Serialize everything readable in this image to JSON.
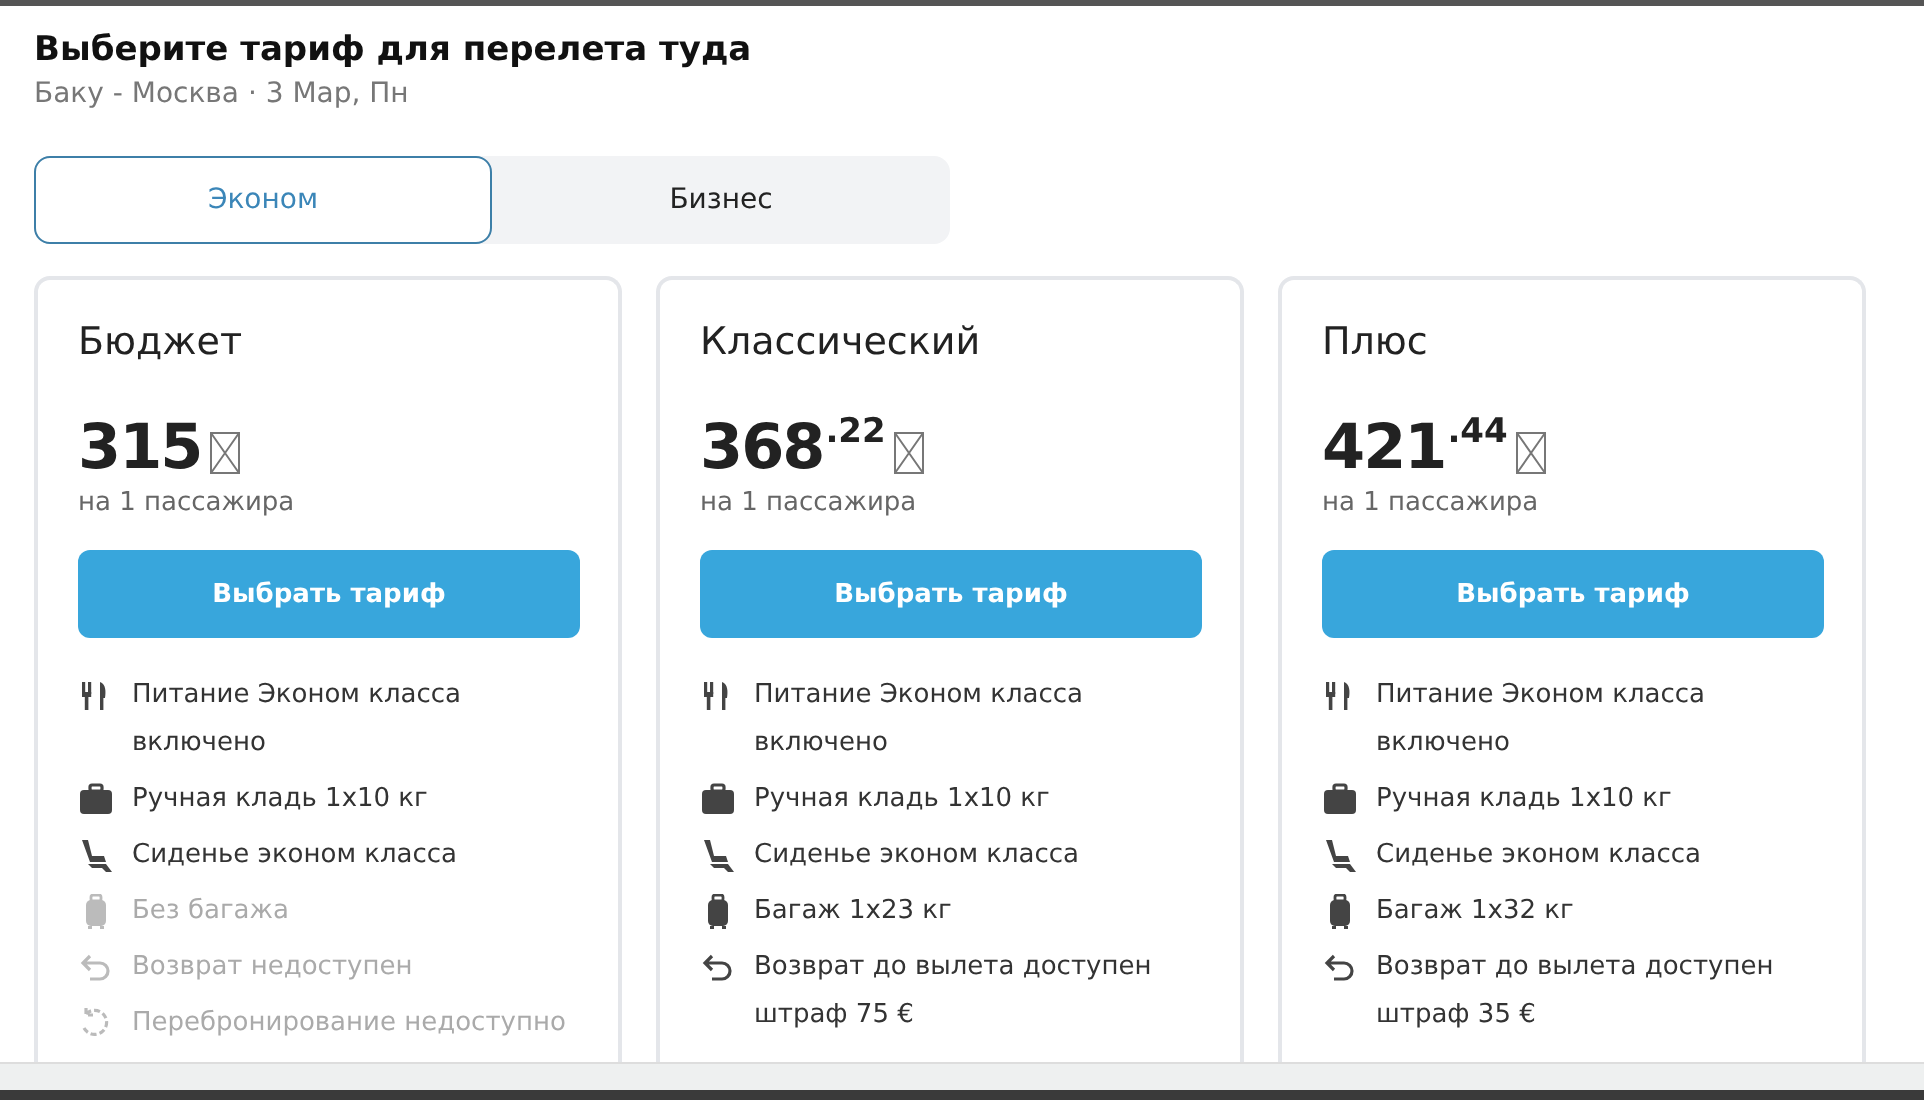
{
  "title": "Выберите тариф для перелета туда",
  "subtitle": "Баку - Москва · 3 Мар, Пн",
  "tabs": [
    {
      "label": "Эконом",
      "selected": true
    },
    {
      "label": "Бизнес",
      "selected": false
    }
  ],
  "fares": [
    {
      "name": "Бюджет",
      "price": "315",
      "per": "на 1 пассажира",
      "button": "Выбрать тариф",
      "features": [
        {
          "kind": "meal",
          "text": "Питание Эконом класса включено",
          "available": true
        },
        {
          "kind": "hand-luggage",
          "text": "Ручная кладь 1x10 кг",
          "available": true
        },
        {
          "kind": "seat",
          "text": "Сиденье эконом класса",
          "available": true
        },
        {
          "kind": "baggage",
          "text": "Без багажа",
          "available": false
        },
        {
          "kind": "refund",
          "text": "Возврат недоступен",
          "available": false
        },
        {
          "kind": "rebooking",
          "text": "Перебронирование недоступно",
          "available": false
        }
      ]
    },
    {
      "name": "Классический",
      "price": "368",
      "cents": ".22",
      "per": "на 1 пассажира",
      "button": "Выбрать тариф",
      "features": [
        {
          "kind": "meal",
          "text": "Питание Эконом класса включено",
          "available": true
        },
        {
          "kind": "hand-luggage",
          "text": "Ручная кладь 1x10 кг",
          "available": true
        },
        {
          "kind": "seat",
          "text": "Сиденье эконом класса",
          "available": true
        },
        {
          "kind": "baggage",
          "text": "Багаж 1x23 кг",
          "available": true
        },
        {
          "kind": "refund",
          "text": "Возврат до вылета доступен штраф 75 €",
          "available": true
        }
      ]
    },
    {
      "name": "Плюс",
      "price": "421",
      "cents": ".44",
      "per": "на 1 пассажира",
      "button": "Выбрать тариф",
      "features": [
        {
          "kind": "meal",
          "text": "Питание Эконом класса включено",
          "available": true
        },
        {
          "kind": "hand-luggage",
          "text": "Ручная кладь 1x10 кг",
          "available": true
        },
        {
          "kind": "seat",
          "text": "Сиденье эконом класса",
          "available": true
        },
        {
          "kind": "baggage",
          "text": "Багаж 1x32 кг",
          "available": true
        },
        {
          "kind": "refund",
          "text": "Возврат до вылета доступен штраф 35 €",
          "available": true
        }
      ]
    }
  ]
}
